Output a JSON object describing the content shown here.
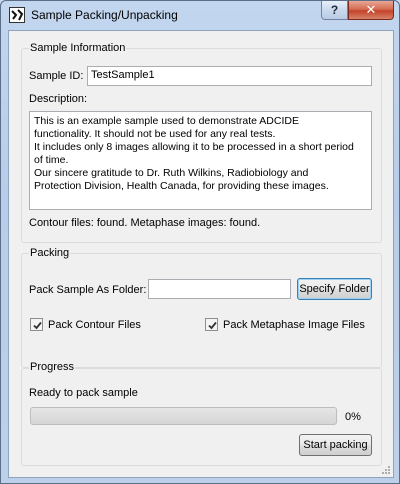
{
  "window": {
    "title": "Sample Packing/Unpacking",
    "help_glyph": "?",
    "close_glyph": "✕",
    "icon": "app-logo-icon"
  },
  "sample_info": {
    "group_title": "Sample Information",
    "id_label": "Sample ID:",
    "id_value": "TestSample1",
    "description_label": "Description:",
    "description_text": "This is an example sample used to demonstrate ADCIDE\nfunctionality. It should not be used for any real tests.\nIt includes only 8 images allowing it to be processed in a short period\nof time.\nOur sincere gratitude to Dr. Ruth Wilkins, Radiobiology and\nProtection Division, Health Canada, for providing these images.",
    "status_text": "Contour files: found. Metaphase images: found."
  },
  "packing": {
    "group_title": "Packing",
    "folder_label": "Pack Sample As Folder:",
    "folder_value": "",
    "specify_button": "Specify Folder",
    "contour_checkbox": {
      "label": "Pack Contour Files",
      "checked": true
    },
    "metaphase_checkbox": {
      "label": "Pack Metaphase Image Files",
      "checked": true
    }
  },
  "progress": {
    "group_title": "Progress",
    "status_text": "Ready to pack sample",
    "value": 0,
    "percent_text": "0%",
    "start_button": "Start packing",
    "fill_color": "#06b025"
  }
}
